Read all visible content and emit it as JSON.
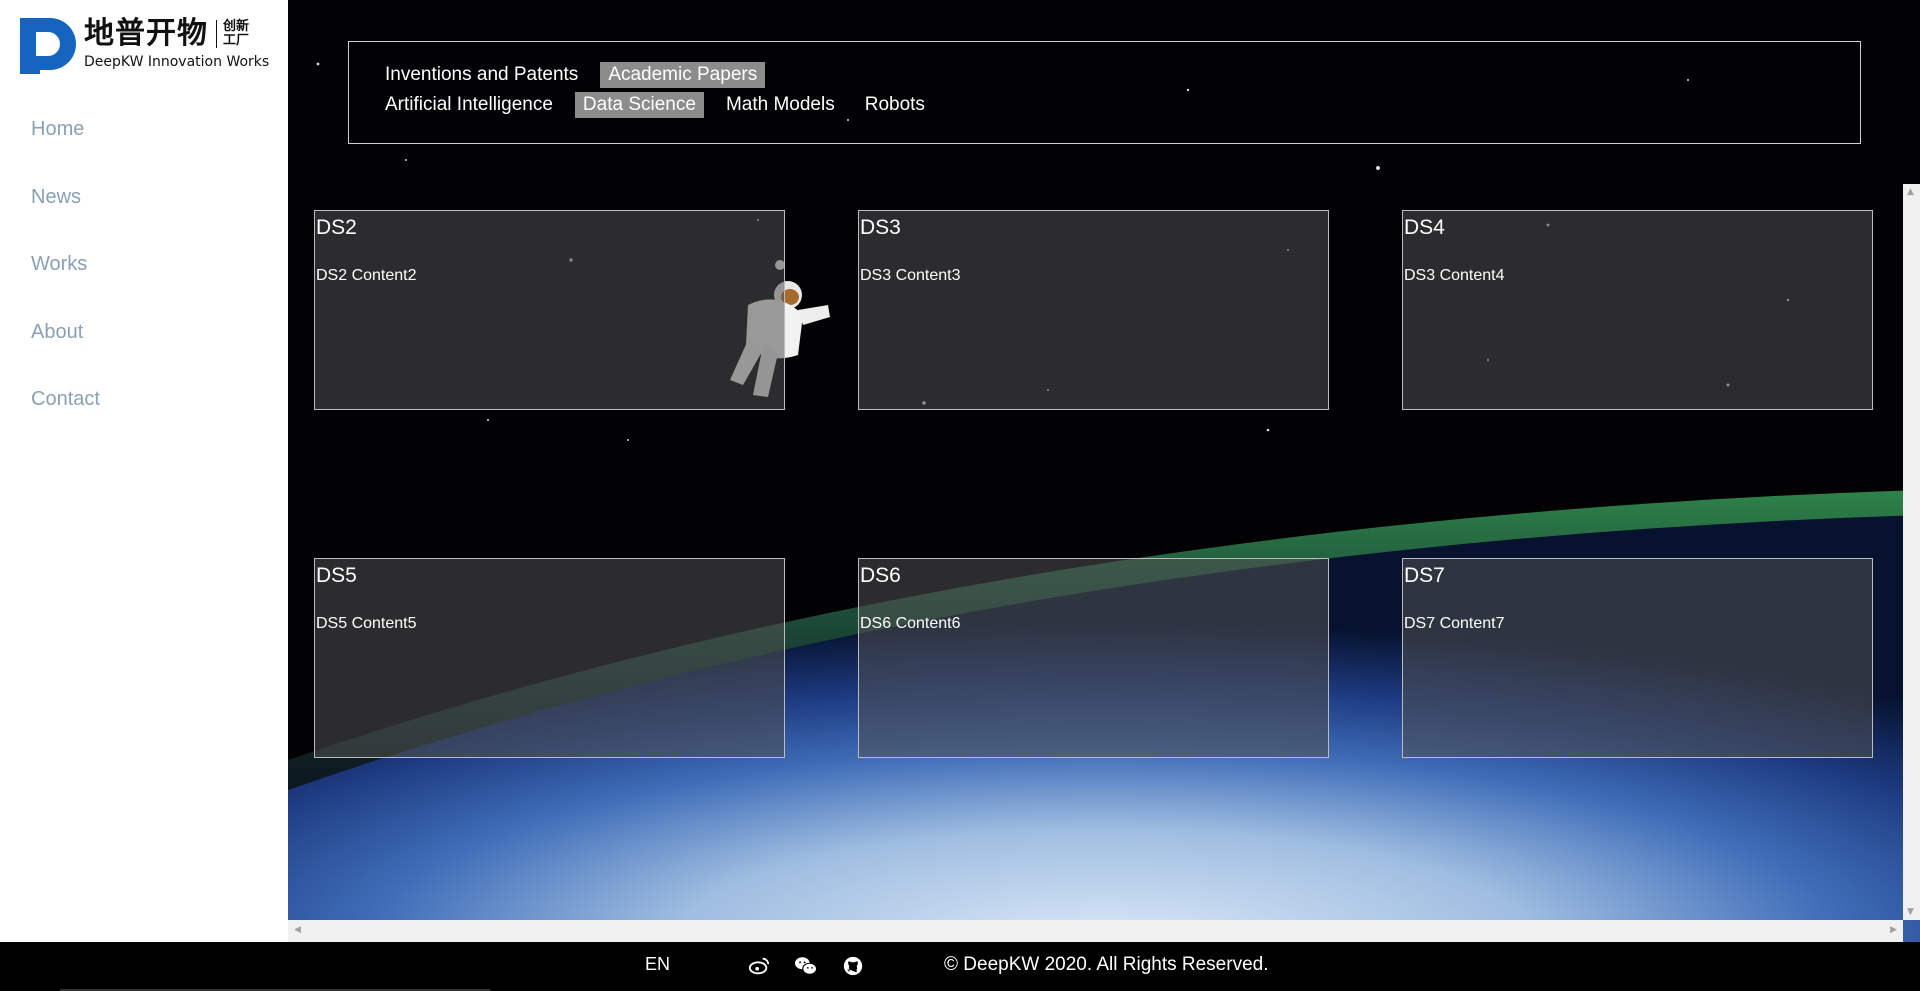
{
  "brand": {
    "name_cn": "地普开物",
    "tag_cn_top": "创新",
    "tag_cn_bottom": "工厂",
    "name_en": "DeepKW Innovation Works",
    "color": "#1565c0"
  },
  "nav": {
    "items": [
      {
        "label": "Home"
      },
      {
        "label": "News"
      },
      {
        "label": "Works"
      },
      {
        "label": "About"
      },
      {
        "label": "Contact"
      }
    ]
  },
  "filters": {
    "row1": [
      {
        "label": "Inventions and Patents",
        "active": false
      },
      {
        "label": "Academic Papers",
        "active": true
      }
    ],
    "row2": [
      {
        "label": "Artificial Intelligence",
        "active": false
      },
      {
        "label": "Data Science",
        "active": true
      },
      {
        "label": "Math Models",
        "active": false
      },
      {
        "label": "Robots",
        "active": false
      }
    ]
  },
  "cards": [
    {
      "title": "DS2",
      "content": "DS2 Content2"
    },
    {
      "title": "DS3",
      "content": "DS3 Content3"
    },
    {
      "title": "DS4",
      "content": "DS3 Content4"
    },
    {
      "title": "DS5",
      "content": "DS5 Content5"
    },
    {
      "title": "DS6",
      "content": "DS6 Content6"
    },
    {
      "title": "DS7",
      "content": "DS7 Content7"
    }
  ],
  "footer": {
    "lang": "EN",
    "icons": [
      "weibo-icon",
      "wechat-icon",
      "github-icon"
    ],
    "copyright": "© DeepKW 2020. All Rights Reserved."
  }
}
